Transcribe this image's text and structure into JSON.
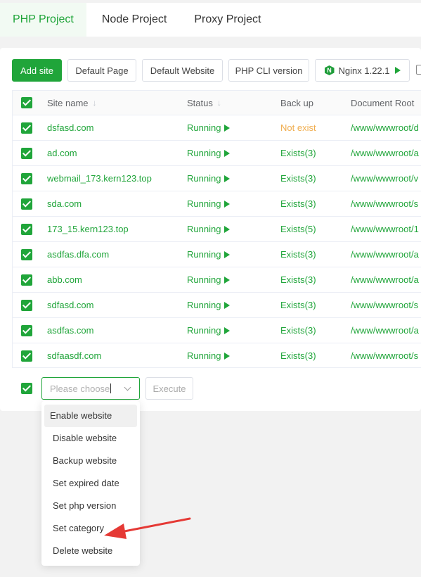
{
  "tabs": [
    {
      "label": "PHP Project"
    },
    {
      "label": "Node Project"
    },
    {
      "label": "Proxy Project"
    }
  ],
  "toolbar": {
    "add_site": "Add site",
    "default_page": "Default Page",
    "default_website": "Default Website",
    "php_cli": "PHP CLI version",
    "nginx": "Nginx 1.22.1"
  },
  "table": {
    "headers": {
      "name": "Site name",
      "status": "Status",
      "backup": "Back up",
      "root": "Document Root"
    },
    "rows": [
      {
        "name": "dsfasd.com",
        "status": "Running",
        "backup": "Not exist",
        "root": "/www/wwwroot/d"
      },
      {
        "name": "ad.com",
        "status": "Running",
        "backup": "Exists(3)",
        "root": "/www/wwwroot/a"
      },
      {
        "name": "webmail_173.kern123.top",
        "status": "Running",
        "backup": "Exists(3)",
        "root": "/www/wwwroot/v"
      },
      {
        "name": "sda.com",
        "status": "Running",
        "backup": "Exists(3)",
        "root": "/www/wwwroot/s"
      },
      {
        "name": "173_15.kern123.top",
        "status": "Running",
        "backup": "Exists(5)",
        "root": "/www/wwwroot/1"
      },
      {
        "name": "asdfas.dfa.com",
        "status": "Running",
        "backup": "Exists(3)",
        "root": "/www/wwwroot/a"
      },
      {
        "name": "abb.com",
        "status": "Running",
        "backup": "Exists(3)",
        "root": "/www/wwwroot/a"
      },
      {
        "name": "sdfasd.com",
        "status": "Running",
        "backup": "Exists(3)",
        "root": "/www/wwwroot/s"
      },
      {
        "name": "asdfas.com",
        "status": "Running",
        "backup": "Exists(3)",
        "root": "/www/wwwroot/a"
      },
      {
        "name": "sdfaasdf.com",
        "status": "Running",
        "backup": "Exists(3)",
        "root": "/www/wwwroot/s"
      }
    ]
  },
  "batch": {
    "placeholder": "Please choose",
    "execute": "Execute"
  },
  "dropdown": {
    "items": [
      {
        "label": "Enable website"
      },
      {
        "label": "Disable website"
      },
      {
        "label": "Backup website"
      },
      {
        "label": "Set expired date"
      },
      {
        "label": "Set php version"
      },
      {
        "label": "Set category"
      },
      {
        "label": "Delete website"
      }
    ]
  },
  "colors": {
    "accent": "#20a53a",
    "warning": "#f0ad4e",
    "annotation_arrow": "#e53935"
  },
  "icons": {
    "sort": "sort-down-icon",
    "running": "play-icon",
    "nginx": "nginx-logo-icon",
    "checkbox": "checkbox-checked-icon",
    "select_caret": "chevron-down-icon"
  }
}
